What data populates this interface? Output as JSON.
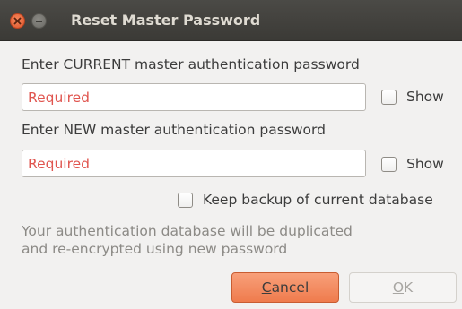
{
  "window": {
    "title": "Reset Master Password"
  },
  "current_password": {
    "label": "Enter CURRENT master authentication password",
    "placeholder": "Required",
    "show_label": "Show"
  },
  "new_password": {
    "label": "Enter NEW master authentication password",
    "placeholder": "Required",
    "show_label": "Show"
  },
  "backup": {
    "label": "Keep backup of current database"
  },
  "info": {
    "line1": "Your authentication database will be duplicated",
    "line2": "and re-encrypted using new password"
  },
  "buttons": {
    "cancel_first": "C",
    "cancel_rest": "ancel",
    "ok_first": "O",
    "ok_rest": "K"
  },
  "colors": {
    "accent": "#ef7b4d",
    "required_placeholder": "#e0554f",
    "titlebar": "#3c3b37"
  }
}
